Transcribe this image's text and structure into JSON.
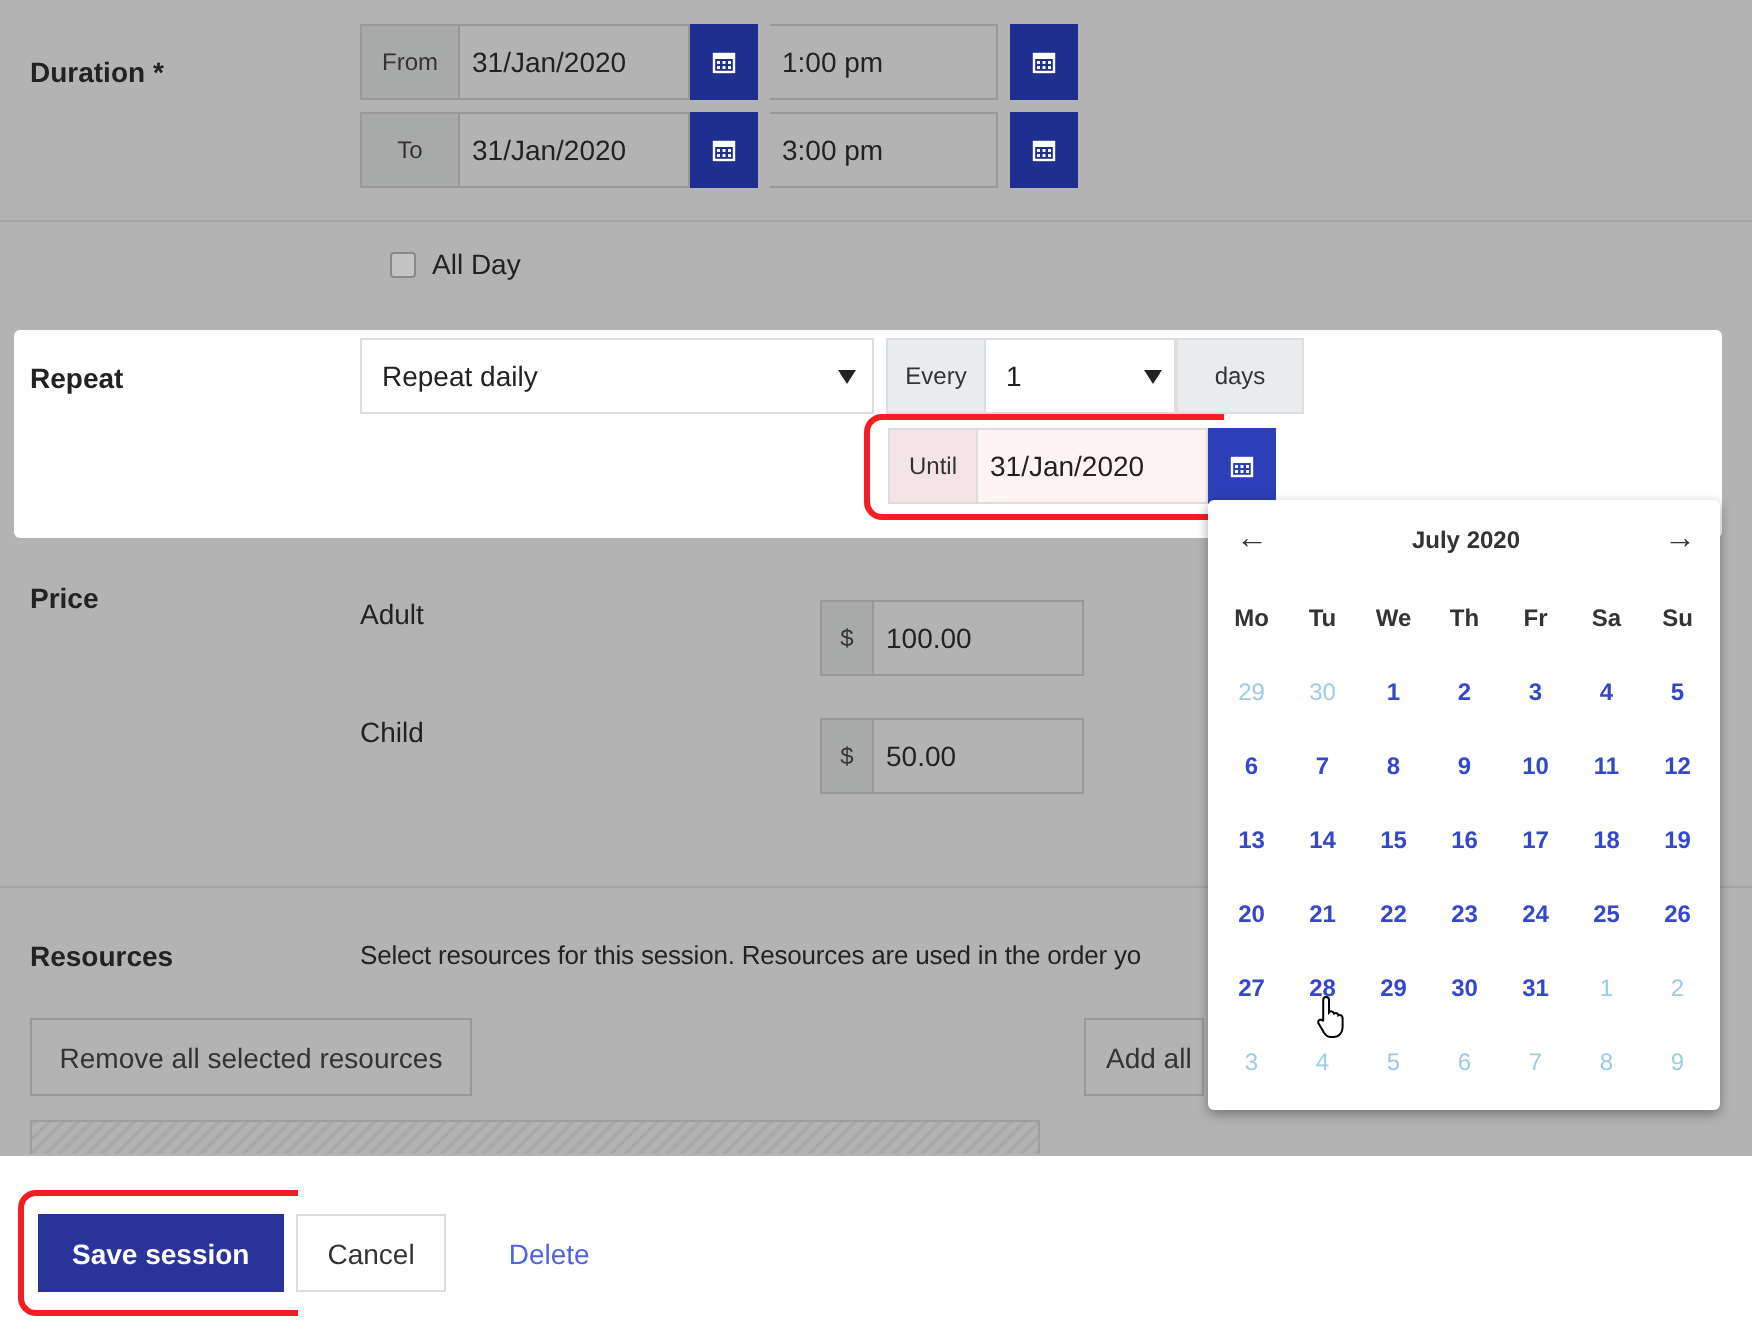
{
  "duration": {
    "label": "Duration *",
    "rows": [
      {
        "addon": "From",
        "date": "31/Jan/2020",
        "time": "1:00 pm"
      },
      {
        "addon": "To",
        "date": "31/Jan/2020",
        "time": "3:00 pm"
      }
    ]
  },
  "all_day": {
    "label": "All Day",
    "checked": false
  },
  "repeat": {
    "label": "Repeat",
    "frequency": "Repeat daily",
    "every_label": "Every",
    "every_value": "1",
    "unit": "days",
    "until_label": "Until",
    "until_value": "31/Jan/2020",
    "highlighted": true
  },
  "price": {
    "label": "Price",
    "items": [
      {
        "name": "Adult",
        "currency": "$",
        "value": "100.00"
      },
      {
        "name": "Child",
        "currency": "$",
        "value": "50.00"
      }
    ]
  },
  "resources": {
    "label": "Resources",
    "description": "Select resources for this session. Resources are used in the order yo",
    "buttons": [
      "Remove all selected resources",
      "Add all"
    ]
  },
  "calendar": {
    "month": "July 2020",
    "prev": "←",
    "next": "→",
    "weekdays": [
      "Mo",
      "Tu",
      "We",
      "Th",
      "Fr",
      "Sa",
      "Su"
    ],
    "weeks": [
      [
        {
          "day": "29",
          "outside": true
        },
        {
          "day": "30",
          "outside": true
        },
        {
          "day": "1",
          "outside": false
        },
        {
          "day": "2",
          "outside": false
        },
        {
          "day": "3",
          "outside": false
        },
        {
          "day": "4",
          "outside": false
        },
        {
          "day": "5",
          "outside": false
        }
      ],
      [
        {
          "day": "6",
          "outside": false
        },
        {
          "day": "7",
          "outside": false
        },
        {
          "day": "8",
          "outside": false
        },
        {
          "day": "9",
          "outside": false
        },
        {
          "day": "10",
          "outside": false
        },
        {
          "day": "11",
          "outside": false
        },
        {
          "day": "12",
          "outside": false
        }
      ],
      [
        {
          "day": "13",
          "outside": false
        },
        {
          "day": "14",
          "outside": false
        },
        {
          "day": "15",
          "outside": false
        },
        {
          "day": "16",
          "outside": false
        },
        {
          "day": "17",
          "outside": false
        },
        {
          "day": "18",
          "outside": false
        },
        {
          "day": "19",
          "outside": false
        }
      ],
      [
        {
          "day": "20",
          "outside": false
        },
        {
          "day": "21",
          "outside": false
        },
        {
          "day": "22",
          "outside": false
        },
        {
          "day": "23",
          "outside": false
        },
        {
          "day": "24",
          "outside": false
        },
        {
          "day": "25",
          "outside": false
        },
        {
          "day": "26",
          "outside": false
        }
      ],
      [
        {
          "day": "27",
          "outside": false
        },
        {
          "day": "28",
          "outside": false
        },
        {
          "day": "29",
          "outside": false
        },
        {
          "day": "30",
          "outside": false
        },
        {
          "day": "31",
          "outside": false
        },
        {
          "day": "1",
          "outside": true
        },
        {
          "day": "2",
          "outside": true
        }
      ],
      [
        {
          "day": "3",
          "outside": true
        },
        {
          "day": "4",
          "outside": true
        },
        {
          "day": "5",
          "outside": true
        },
        {
          "day": "6",
          "outside": true
        },
        {
          "day": "7",
          "outside": true
        },
        {
          "day": "8",
          "outside": true
        },
        {
          "day": "9",
          "outside": true
        }
      ]
    ]
  },
  "actions": [
    {
      "label": "Save session",
      "kind": "primary",
      "highlighted": true
    },
    {
      "label": "Cancel",
      "kind": "secondary",
      "highlighted": false
    },
    {
      "label": "Delete",
      "kind": "link",
      "highlighted": false
    }
  ]
}
